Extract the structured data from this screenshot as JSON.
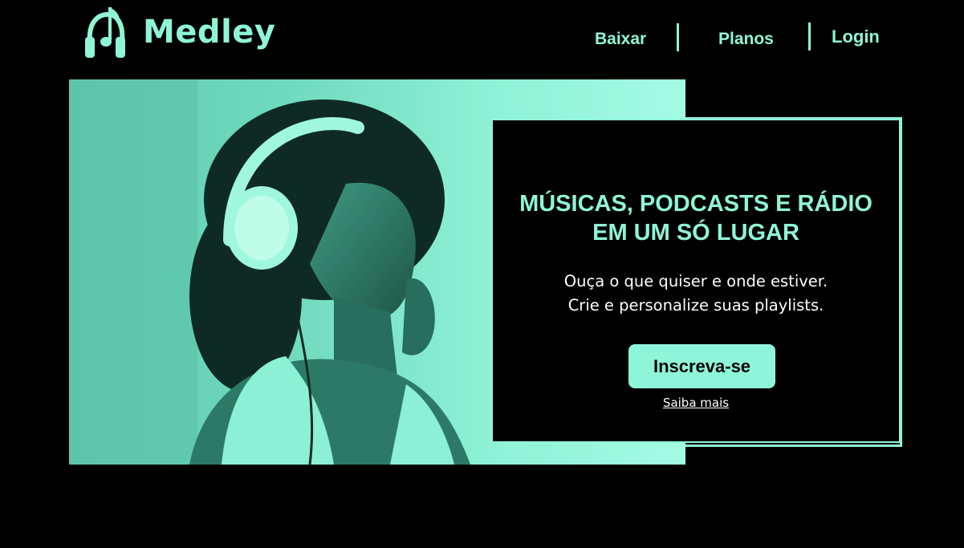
{
  "brand": {
    "name": "Medley",
    "logo_icon": "headphones-music-note-icon"
  },
  "nav": {
    "items": [
      {
        "label": "Baixar"
      },
      {
        "label": "Planos"
      },
      {
        "label": "Login"
      }
    ]
  },
  "hero": {
    "image_icon": "woman-with-headphones-photo"
  },
  "promo": {
    "title_line1": "MÚSICAS, PODCASTS E RÁDIO",
    "title_line2": "EM UM SÓ LUGAR",
    "text_line1": "Ouça o que quiser e onde estiver.",
    "text_line2": "Crie e personalize suas playlists.",
    "cta_label": "Inscreva-se",
    "more_label": "Saiba mais"
  },
  "colors": {
    "accent": "#8ff5d8",
    "background": "#000000",
    "text": "#ffffff"
  }
}
